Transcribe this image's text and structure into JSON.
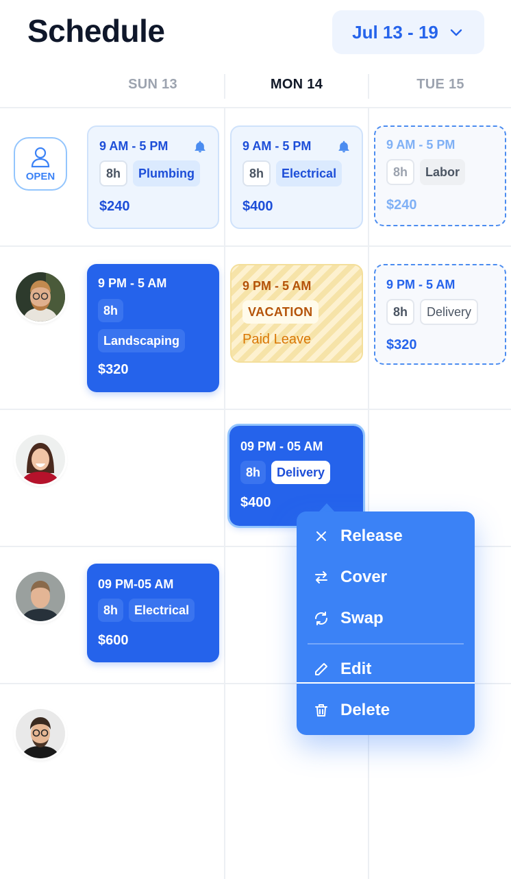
{
  "header": {
    "title": "Schedule",
    "date_range": "Jul 13 - 19"
  },
  "days": [
    {
      "label": "SUN 13",
      "active": false
    },
    {
      "label": "MON 14",
      "active": true
    },
    {
      "label": "TUE 15",
      "active": false
    }
  ],
  "open_label": "OPEN",
  "shifts": {
    "open_sun": {
      "time": "9 AM - 5 PM",
      "hours": "8h",
      "role": "Plumbing",
      "price": "$240"
    },
    "open_mon": {
      "time": "9 AM - 5 PM",
      "hours": "8h",
      "role": "Electrical",
      "price": "$400"
    },
    "open_tue": {
      "time": "9 AM - 5 PM",
      "hours": "8h",
      "role": "Labor",
      "price": "$240"
    },
    "p1_sun": {
      "time": "9 PM - 5 AM",
      "hours": "8h",
      "role": "Landscaping",
      "price": "$320"
    },
    "p1_mon": {
      "time": "9 PM - 5 AM",
      "tag": "VACATION",
      "note": "Paid Leave"
    },
    "p1_tue": {
      "time": "9 PM - 5 AM",
      "hours": "8h",
      "role": "Delivery",
      "price": "$320"
    },
    "p2_mon": {
      "time": "09 PM - 05 AM",
      "hours": "8h",
      "role": "Delivery",
      "price": "$400"
    },
    "p3_sun": {
      "time": "09 PM-05 AM",
      "hours": "8h",
      "role": "Electrical",
      "price": "$600"
    }
  },
  "menu": {
    "release": "Release",
    "cover": "Cover",
    "swap": "Swap",
    "edit": "Edit",
    "delete": "Delete"
  },
  "colors": {
    "primary": "#2563eb",
    "menu": "#3b82f6",
    "vacation": "#b45309"
  }
}
